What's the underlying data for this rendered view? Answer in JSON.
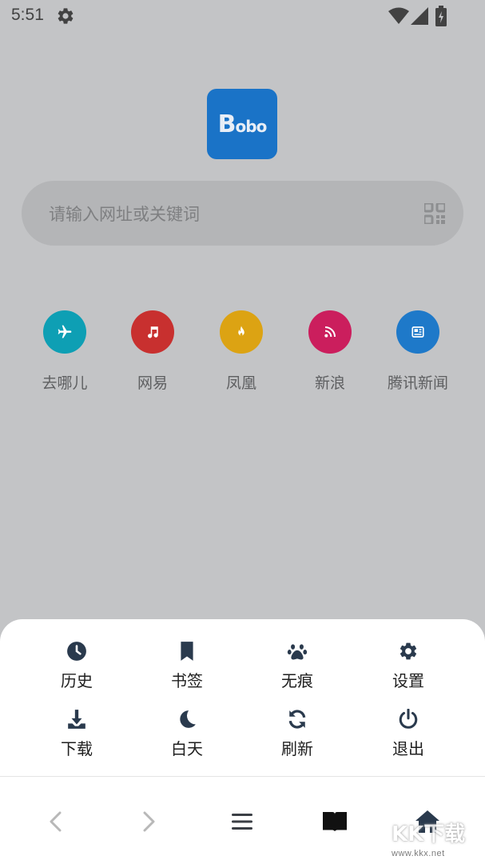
{
  "status_bar": {
    "time": "5:51",
    "icons": [
      "gear-icon",
      "wifi-icon",
      "signal-icon",
      "battery-charging-icon"
    ]
  },
  "logo": {
    "text_big": "B",
    "text_small": "obo",
    "color": "#1a73c7"
  },
  "search": {
    "placeholder": "请输入网址或关键词",
    "icon": "qr-code-icon"
  },
  "shortcuts": [
    {
      "label": "去哪儿",
      "icon": "airplane-icon",
      "color": "#0e9fb4"
    },
    {
      "label": "网易",
      "icon": "music-note-icon",
      "color": "#c8302f"
    },
    {
      "label": "凤凰",
      "icon": "flame-icon",
      "color": "#dca313"
    },
    {
      "label": "新浪",
      "icon": "rss-icon",
      "color": "#cb1e5d"
    },
    {
      "label": "腾讯新闻",
      "icon": "newspaper-icon",
      "color": "#1e79c9"
    }
  ],
  "menu": {
    "items": [
      {
        "label": "历史",
        "icon": "clock-icon"
      },
      {
        "label": "书签",
        "icon": "bookmark-icon"
      },
      {
        "label": "无痕",
        "icon": "paw-icon"
      },
      {
        "label": "设置",
        "icon": "gear-icon"
      },
      {
        "label": "下载",
        "icon": "download-icon"
      },
      {
        "label": "白天",
        "icon": "moon-icon"
      },
      {
        "label": "刷新",
        "icon": "refresh-icon"
      },
      {
        "label": "退出",
        "icon": "power-icon"
      }
    ]
  },
  "bottom_nav": {
    "items": [
      "back-icon",
      "forward-icon",
      "menu-icon",
      "book-icon",
      "home-icon"
    ]
  },
  "watermark": {
    "text": "KK下载",
    "url": "www.kkx.net"
  }
}
